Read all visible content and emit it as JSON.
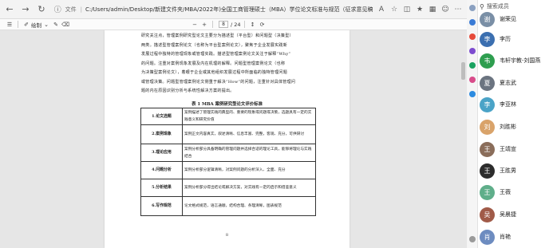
{
  "browser": {
    "file_label": "文件",
    "url": "C:/Users/admin/Desktop/新建文件夹/MBA/2022年)全国工商管理硕士（MBA）学位论文标准与规范（征求意见稿）》公开征求意见的通知(1).pdf",
    "icons": [
      "back-icon",
      "forward-icon",
      "refresh-icon",
      "info-icon",
      "read-aloud-icon",
      "star-icon",
      "split-icon",
      "favorites-icon",
      "collections-icon",
      "profile-icon",
      "more-icon"
    ]
  },
  "pdf_toolbar": {
    "draw_label": "绘制",
    "page_current": "8",
    "page_total": "/ 24"
  },
  "document": {
    "paragraph": [
      "研究关注点，管理案例研究型论文主要分为描述型（平台型）和问题型（决策型）",
      "两类。描述型管理案例论文（也称为平台型案例论文），聚焦于企业发展实践新",
      "发展过程中独特的管理现象或管理实践。描述型管理案例论文关注于解释“Why”",
      "的问题。注重对案例现象发展及内在机理的解释。问题型管理案例论文（也称",
      "为决策型案例论文），着眼于企业或其他组织发展过程中所面临的独特管理问题",
      "或管理决策。问题型管理案例论文侧重于解决“How”的问题，注重针对具体管理问",
      "题的内在原因识别分析与系统性解决方案的提出。"
    ],
    "table_title": "表 1 MBA 案例研究型论文评价标准",
    "rubric": [
      {
        "key": "1.论文选题",
        "value": "案例描述了管理实践的典型的、重要的现象或问题或决策，选题具有一定的实践意义和研究价值"
      },
      {
        "key": "2.案例现象",
        "value": "案例正文内容真实，叙述清晰、信息丰富、完整，客观、充分，可供研讨"
      },
      {
        "key": "3.理论应用",
        "value": "案例分析部分具备明确的管理问题并选择合适的理论工具，能够将理论与实践结合"
      },
      {
        "key": "4.问题分析",
        "value": "案例分析部分逻辑清晰，对案例问题的分析深入、全面、充分"
      },
      {
        "key": "5.分析结果",
        "value": "案例分析部分得出结论或解决方案，对实践有一定的启示和借鉴意义"
      },
      {
        "key": "6.写作规范",
        "value": "论文格式规范，语言通顺，结构合理、条理清晰，图表规范"
      }
    ],
    "page_number": "8"
  },
  "side_panel": {
    "search_placeholder": "搜索成员",
    "contacts": [
      {
        "name": "谢荣见",
        "color": "#7a8fa6",
        "initial": "谢"
      },
      {
        "name": "李历",
        "color": "#3b6fb0",
        "initial": "李"
      },
      {
        "name": "韦轩宇教-刘国燕",
        "color": "#2e9e4f",
        "initial": "韦"
      },
      {
        "name": "夏志武",
        "color": "#6b7480",
        "initial": "夏"
      },
      {
        "name": "李亚林",
        "color": "#4aa3c7",
        "initial": "李"
      },
      {
        "name": "刘胜彬",
        "color": "#d9a36a",
        "initial": "刘"
      },
      {
        "name": "王靖宣",
        "color": "#8a6d5a",
        "initial": "王"
      },
      {
        "name": "王胜男",
        "color": "#2c2c2c",
        "initial": "王"
      },
      {
        "name": "王薇",
        "color": "#5fae8a",
        "initial": "王"
      },
      {
        "name": "吴晨捷",
        "color": "#a05a48",
        "initial": "吴"
      },
      {
        "name": "肖艳",
        "color": "#6d8cc0",
        "initial": "肖"
      }
    ]
  }
}
